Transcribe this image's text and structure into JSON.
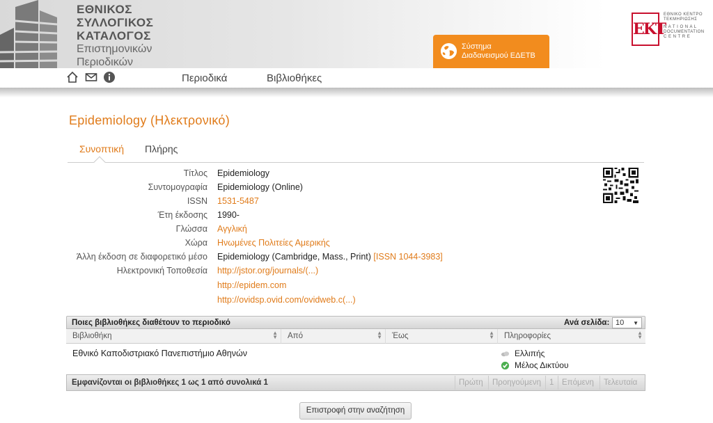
{
  "header": {
    "logo_lines_bold": [
      "ΕΘΝΙΚΟΣ",
      "ΣΥΛΛΟΓΙΚΟΣ",
      "ΚΑΤΑΛΟΓΟΣ"
    ],
    "logo_lines_normal": [
      "Επιστημονικών",
      "Περιοδικών"
    ],
    "edetb_button": [
      "Σύστημα",
      "Διαδανεισμού ΕΔΕΤΒ"
    ],
    "ekt_mark": "EKT",
    "ekt_lines": [
      "ΕΘΝΙΚΟ ΚΕΝΤΡΟ",
      "ΤΕΚΜΗΡΙΩΣΗΣ",
      "N A T I O N A L",
      "DOCUMENTATION",
      "C E N T R E"
    ],
    "accent_color": "#f28c1e",
    "ekt_color": "#c8102e"
  },
  "nav": {
    "icons": [
      "home-icon",
      "mail-icon",
      "info-icon"
    ],
    "links": [
      "Περιοδικά",
      "Βιβλιοθήκες"
    ]
  },
  "page": {
    "title": "Epidemiology (Ηλεκτρονικό)",
    "tabs": [
      "Συνοπτική",
      "Πλήρης"
    ],
    "active_tab": "Συνοπτική"
  },
  "details": {
    "rows": [
      {
        "label": "Τίτλος",
        "value": "Epidemiology"
      },
      {
        "label": "Συντομογραφία",
        "value": "Epidemiology (Online)"
      },
      {
        "label": "ISSN",
        "value": "1531-5487"
      },
      {
        "label": "Έτη έκδοσης",
        "value": "1990-"
      },
      {
        "label": "Γλώσσα",
        "value": "Αγγλική"
      },
      {
        "label": "Χώρα",
        "value": "Ηνωμένες Πολιτείες Αμερικής"
      },
      {
        "label": "Άλλη έκδοση σε διαφορετικό μέσο",
        "value": "Epidemiology (Cambridge, Mass., Print)",
        "link": "[ISSN 1044-3983]"
      },
      {
        "label": "Ηλεκτρονική Τοποθεσία",
        "value": "http://jstor.org/journals/(...)"
      },
      {
        "label": "",
        "value": "http://epidem.com"
      },
      {
        "label": "",
        "value": "http://ovidsp.ovid.com/ovidweb.c(...)"
      }
    ]
  },
  "libraries": {
    "heading": "Ποιες βιβλιοθήκες διαθέτουν το περιοδικό",
    "per_page_label": "Ανά σελίδα:",
    "per_page_value": "10",
    "columns": [
      "Βιβλιοθήκη",
      "Από",
      "Έως",
      "Πληροφορίες"
    ],
    "rows": [
      {
        "library": "Εθνικό Καποδιστριακό Πανεπιστήμιο Αθηνών",
        "from": "",
        "to": "",
        "info": [
          "Ελλιπής",
          "Μέλος Δικτύου"
        ]
      }
    ],
    "footer_text": "Εμφανίζονται οι βιβλιοθήκες 1 ως 1 από συνολικά 1",
    "pagination": [
      "Πρώτη",
      "Προηγούμενη",
      "1",
      "Επόμενη",
      "Τελευταία"
    ]
  },
  "back_button": "Επιστροφή στην αναζήτηση"
}
